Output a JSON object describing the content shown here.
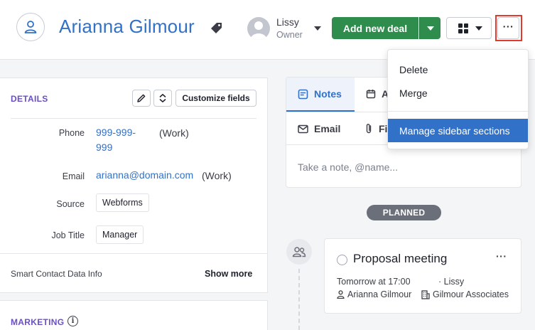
{
  "header": {
    "person_name": "Arianna Gilmour",
    "owner_name": "Lissy",
    "owner_role": "Owner",
    "add_deal_label": "Add new deal",
    "more_label": "···"
  },
  "details": {
    "title": "DETAILS",
    "customize_label": "Customize fields",
    "fields": [
      {
        "label": "Phone",
        "value_line1": "999-999-",
        "value_line2": "999",
        "note": "(Work)"
      },
      {
        "label": "Email",
        "value": "arianna@domain.com",
        "note": "(Work)"
      },
      {
        "label": "Source",
        "value": "Webforms"
      },
      {
        "label": "Job Title",
        "value": "Manager"
      }
    ],
    "smart_data_label": "Smart Contact Data Info",
    "show_more_label": "Show more"
  },
  "marketing": {
    "title": "MARKETING",
    "info_glyph": "i"
  },
  "composer": {
    "tabs": [
      {
        "label": "Notes",
        "icon": "notes-icon"
      },
      {
        "label": "A",
        "icon": "calendar-icon"
      },
      {
        "label": "Email",
        "icon": "email-icon"
      },
      {
        "label": "Fi",
        "icon": "paperclip-icon"
      }
    ],
    "note_placeholder": "Take a note, @name..."
  },
  "timeline": {
    "section_badge": "PLANNED",
    "activity": {
      "title": "Proposal meeting",
      "more_label": "···",
      "time": "Tomorrow at 17:00",
      "owner": "·  Lissy",
      "person": "Arianna Gilmour",
      "organization": "Gilmour Associates"
    }
  },
  "dropdown_menu": {
    "items": [
      {
        "label": "Delete"
      },
      {
        "label": "Merge"
      },
      {
        "label": "Manage sidebar sections",
        "active": true
      }
    ]
  },
  "colors": {
    "accent_blue": "#3171c8",
    "primary_green": "#2e8c4c",
    "section_purple": "#6a4fc4",
    "highlight_red": "#e23b2e"
  }
}
